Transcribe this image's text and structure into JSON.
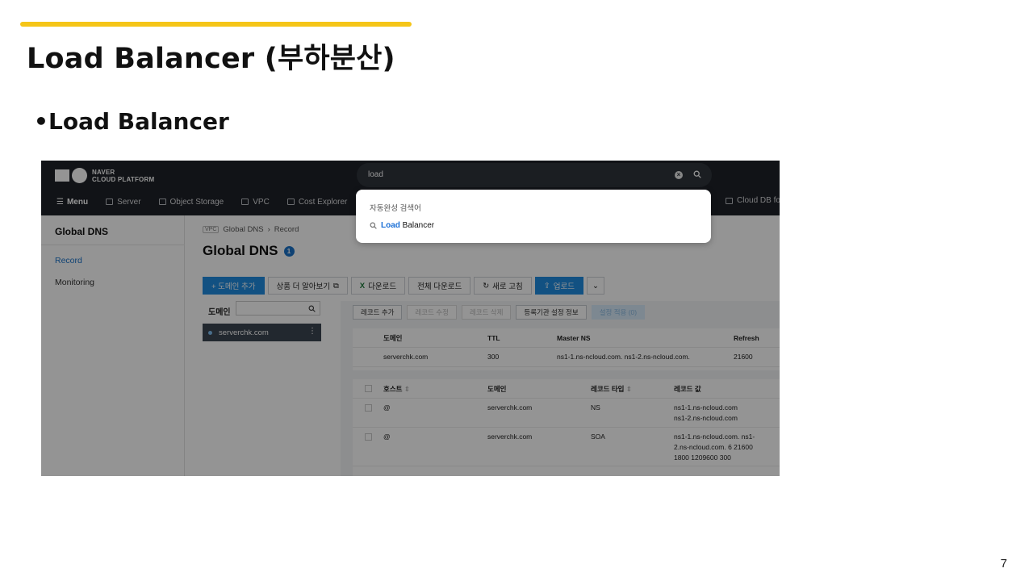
{
  "slide": {
    "title": "Load Balancer (부하분산)",
    "bullet": "Load Balancer",
    "page_number": "7",
    "accent_color": "#f5c518"
  },
  "console": {
    "logo": {
      "line1": "NAVER",
      "line2": "CLOUD PLATFORM"
    },
    "nav": {
      "menu_label": "Menu",
      "items": [
        {
          "label": "Server",
          "icon": "server-icon"
        },
        {
          "label": "Object Storage",
          "icon": "storage-icon"
        },
        {
          "label": "VPC",
          "icon": "vpc-icon"
        },
        {
          "label": "Cost Explorer",
          "icon": "cost-icon"
        }
      ],
      "right_item": "Cloud DB for"
    },
    "search": {
      "value": "load",
      "suggest_header": "자동완성 검색어",
      "suggestion_highlight": "Load",
      "suggestion_rest": " Balancer"
    },
    "sidebar": {
      "title": "Global DNS",
      "items": [
        {
          "label": "Record",
          "active": true
        },
        {
          "label": "Monitoring",
          "active": false
        }
      ]
    },
    "breadcrumb": {
      "tag": "VPC",
      "parent": "Global DNS",
      "current": "Record"
    },
    "page_title": "Global DNS",
    "page_badge": "1",
    "toolbar": {
      "add_domain": "+ 도메인 추가",
      "learn_more": "상품 더 알아보기",
      "download": "다운로드",
      "download_all": "전체 다운로드",
      "refresh": "새로 고침",
      "upload": "업로드"
    },
    "domain_panel": {
      "label": "도메인",
      "domains": [
        "serverchk.com"
      ]
    },
    "record_toolbar": {
      "add": "레코드 추가",
      "edit": "레코드 수정",
      "delete": "레코드 삭제",
      "registrar": "등록기관 설정 정보",
      "apply": "설정 적용 (0)"
    },
    "domain_table": {
      "headers": [
        "도메인",
        "TTL",
        "Master NS",
        "Refresh"
      ],
      "row": [
        "serverchk.com",
        "300",
        "ns1-1.ns-ncloud.com. ns1-2.ns-ncloud.com.",
        "21600"
      ]
    },
    "record_table": {
      "headers": [
        "호스트",
        "도메인",
        "레코드 타입",
        "레코드 값"
      ],
      "rows": [
        {
          "host": "@",
          "domain": "serverchk.com",
          "type": "NS",
          "value_lines": [
            "ns1-1.ns-ncloud.com",
            "ns1-2.ns-ncloud.com"
          ]
        },
        {
          "host": "@",
          "domain": "serverchk.com",
          "type": "SOA",
          "value_lines": [
            "ns1-1.ns-ncloud.com. ns1-",
            "2.ns-ncloud.com. 6 21600",
            "1800 1209600 300"
          ]
        }
      ]
    },
    "colors": {
      "topbar": "#1e2229",
      "primary": "#1f8ce0",
      "link": "#1a73c9"
    }
  }
}
